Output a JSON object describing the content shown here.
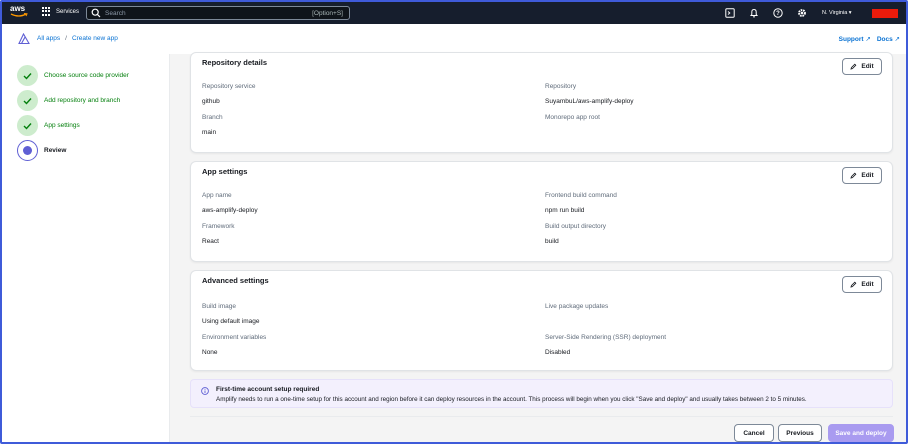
{
  "nav": {
    "logo_text": "aws",
    "services_label": "Services",
    "search_placeholder": "Search",
    "search_shortcut": "[Option+S]",
    "region": "N. Virginia ▾"
  },
  "breadcrumb": {
    "items": [
      "All apps",
      "Create new app"
    ],
    "separator": "/"
  },
  "toplinks": {
    "support": "Support",
    "docs": "Docs"
  },
  "steps": [
    {
      "label": "Choose source code provider",
      "state": "done"
    },
    {
      "label": "Add repository and branch",
      "state": "done"
    },
    {
      "label": "App settings",
      "state": "done"
    },
    {
      "label": "Review",
      "state": "current"
    }
  ],
  "edit_label": "Edit",
  "repo": {
    "title": "Repository details",
    "service_key": "Repository service",
    "service_val": "github",
    "repository_key": "Repository",
    "repository_val": "SuyambuL/aws-amplify-deploy",
    "branch_key": "Branch",
    "branch_val": "main",
    "monorepo_key": "Monorepo app root",
    "monorepo_val": ""
  },
  "app": {
    "title": "App settings",
    "name_key": "App name",
    "name_val": "aws-amplify-deploy",
    "build_cmd_key": "Frontend build command",
    "build_cmd_val": "npm run build",
    "framework_key": "Framework",
    "framework_val": "React",
    "output_key": "Build output directory",
    "output_val": "build"
  },
  "advanced": {
    "title": "Advanced settings",
    "image_key": "Build image",
    "image_val": "Using default image",
    "live_key": "Live package updates",
    "live_val": "",
    "env_key": "Environment variables",
    "env_val": "None",
    "ssr_key": "Server-Side Rendering (SSR) deployment",
    "ssr_val": "Disabled"
  },
  "alert": {
    "title": "First-time account setup required",
    "message": "Amplify needs to run a one-time setup for this account and region before it can deploy resources in the account. This process will begin when you click \"Save and deploy\" and usually takes between 2 to 5 minutes."
  },
  "buttons": {
    "cancel": "Cancel",
    "previous": "Previous",
    "deploy": "Save and deploy"
  },
  "colors": {
    "nav_bg": "#161e2d",
    "link": "#0972d3",
    "success": "#037f0c",
    "brand_purple": "#5f5fd4",
    "deploy_disabled": "#a99bf0",
    "account_redacted": "#ea1b0b"
  }
}
